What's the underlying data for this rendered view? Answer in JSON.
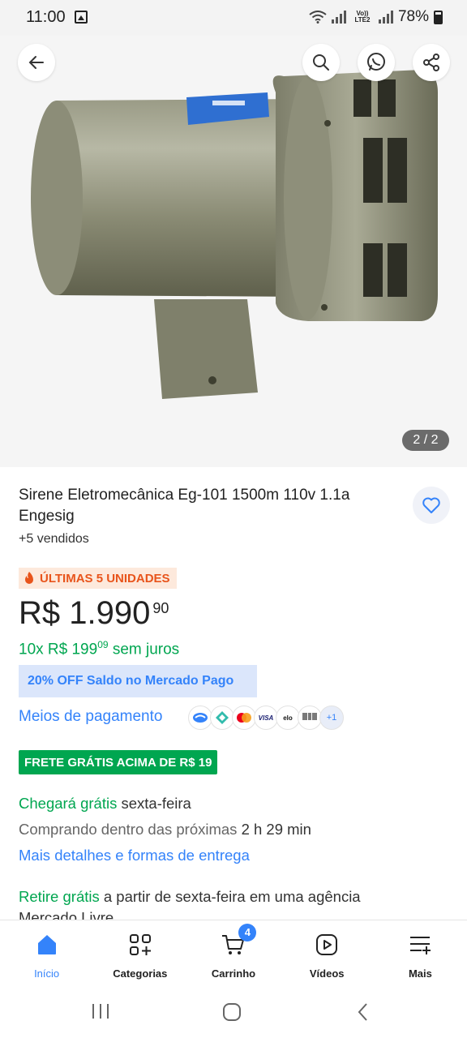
{
  "status_bar": {
    "time": "11:00",
    "battery": "78%",
    "carrier_tag": "Vo)) LTE2"
  },
  "hero": {
    "image_counter": "2 / 2"
  },
  "top_actions": {
    "back": "arrow-left-icon",
    "search": "search-icon",
    "whatsapp": "whatsapp-icon",
    "share": "share-icon"
  },
  "product": {
    "title": "Sirene Eletromecânica Eg-101 1500m 110v 1.1a Engesig",
    "sold": "+5 vendidos",
    "last_units": "ÚLTIMAS 5 UNIDADES",
    "price_main": "R$ 1.990",
    "price_cents": "90",
    "installments_prefix": "10x R$ 199",
    "installments_cents": "09",
    "installments_suffix": "sem juros",
    "promo": "20% OFF Saldo no Mercado Pago",
    "payment_link": "Meios de pagamento",
    "payment_more": "+1",
    "free_shipping_badge": "FRETE GRÁTIS ACIMA DE R$ 19"
  },
  "delivery": {
    "arrives_label": "Chegará grátis",
    "arrives_day": "sexta-feira",
    "buy_within_prefix": "Comprando dentro das próximas",
    "buy_within_time": "2 h 29 min",
    "more_details": "Mais detalhes e formas de entrega",
    "pickup_label": "Retire grátis",
    "pickup_text": "a partir de sexta-feira em uma agência",
    "pickup_text_2": "Mercado Livre"
  },
  "bottom_nav": {
    "items": [
      {
        "label": "Início",
        "icon": "home-icon"
      },
      {
        "label": "Categorias",
        "icon": "categories-icon"
      },
      {
        "label": "Carrinho",
        "icon": "cart-icon",
        "badge": "4"
      },
      {
        "label": "Vídeos",
        "icon": "video-icon"
      },
      {
        "label": "Mais",
        "icon": "menu-more-icon"
      }
    ]
  },
  "colors": {
    "accent": "#3483fa",
    "green": "#00a650",
    "orange": "#e8541b"
  }
}
